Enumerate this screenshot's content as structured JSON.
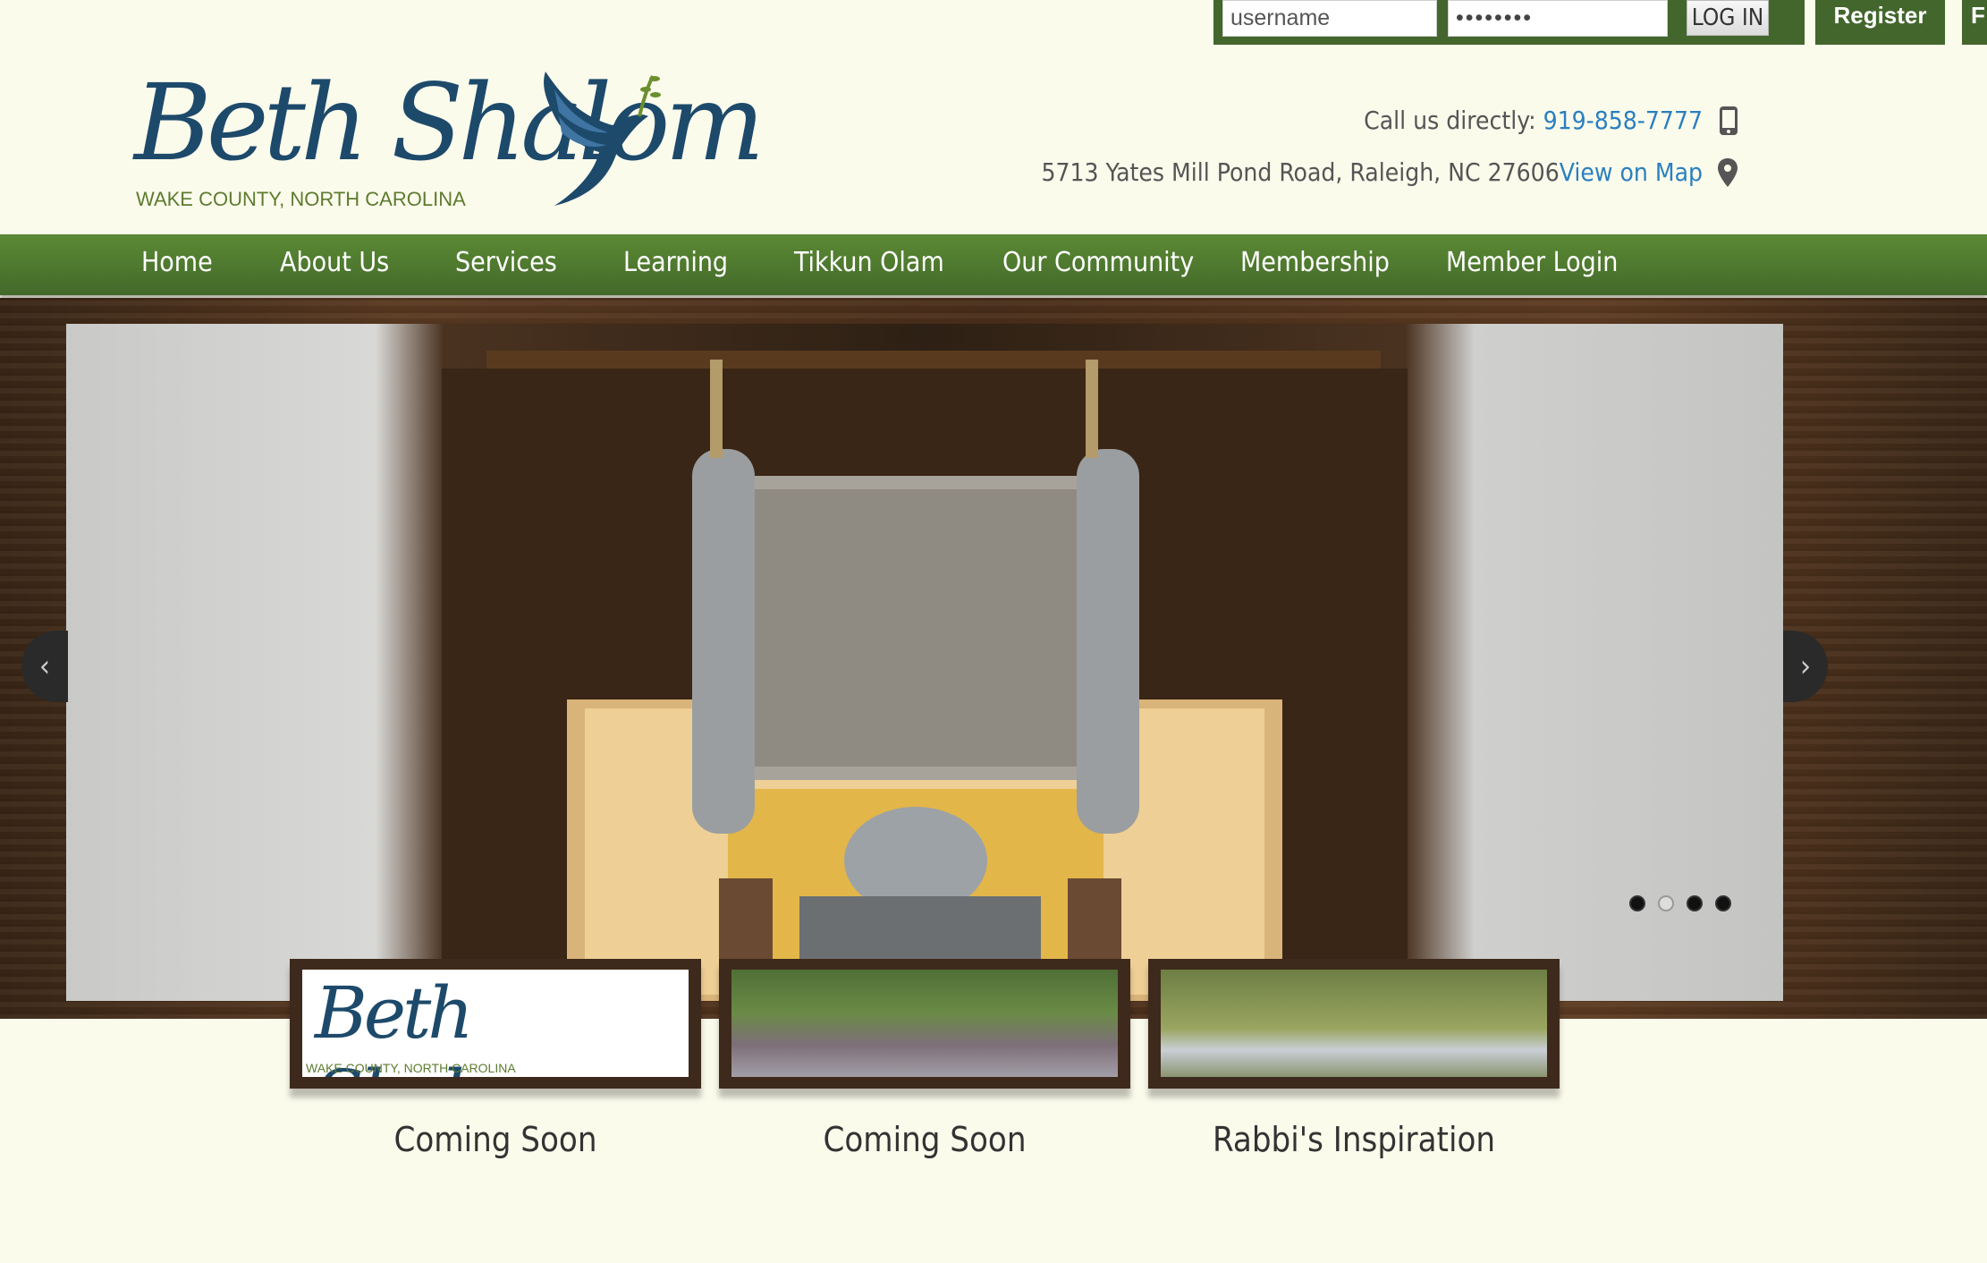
{
  "login": {
    "username_placeholder": "username",
    "password_mask": "••••••••",
    "login_label": "LOG IN",
    "register_label": "Register",
    "extra_label": "F"
  },
  "brand": {
    "logo_text": "Beth Shalom",
    "logo_subtitle": "WAKE COUNTY, NORTH CAROLINA",
    "primary_color": "#1d4a6b",
    "accent_green": "#43662d"
  },
  "contact": {
    "call_label": "Call us directly: ",
    "phone": "919-858-7777",
    "address": "5713 Yates Mill Pond Road, Raleigh, NC 27606",
    "map_link": "View on Map"
  },
  "nav": {
    "items": [
      {
        "label": "Home"
      },
      {
        "label": "About Us"
      },
      {
        "label": "Services"
      },
      {
        "label": "Learning"
      },
      {
        "label": "Tikkun Olam"
      },
      {
        "label": "Our Community"
      },
      {
        "label": "Membership"
      },
      {
        "label": "Member Login"
      }
    ]
  },
  "slider": {
    "total_slides": 4,
    "active_slide": 2
  },
  "features": [
    {
      "label": "Coming Soon"
    },
    {
      "label": "Coming Soon"
    },
    {
      "label": "Rabbi's Inspiration"
    }
  ],
  "icons": {
    "phone": "mobile-phone-icon",
    "map": "map-pin-icon",
    "prev": "chevron-left-icon",
    "next": "chevron-right-icon"
  }
}
